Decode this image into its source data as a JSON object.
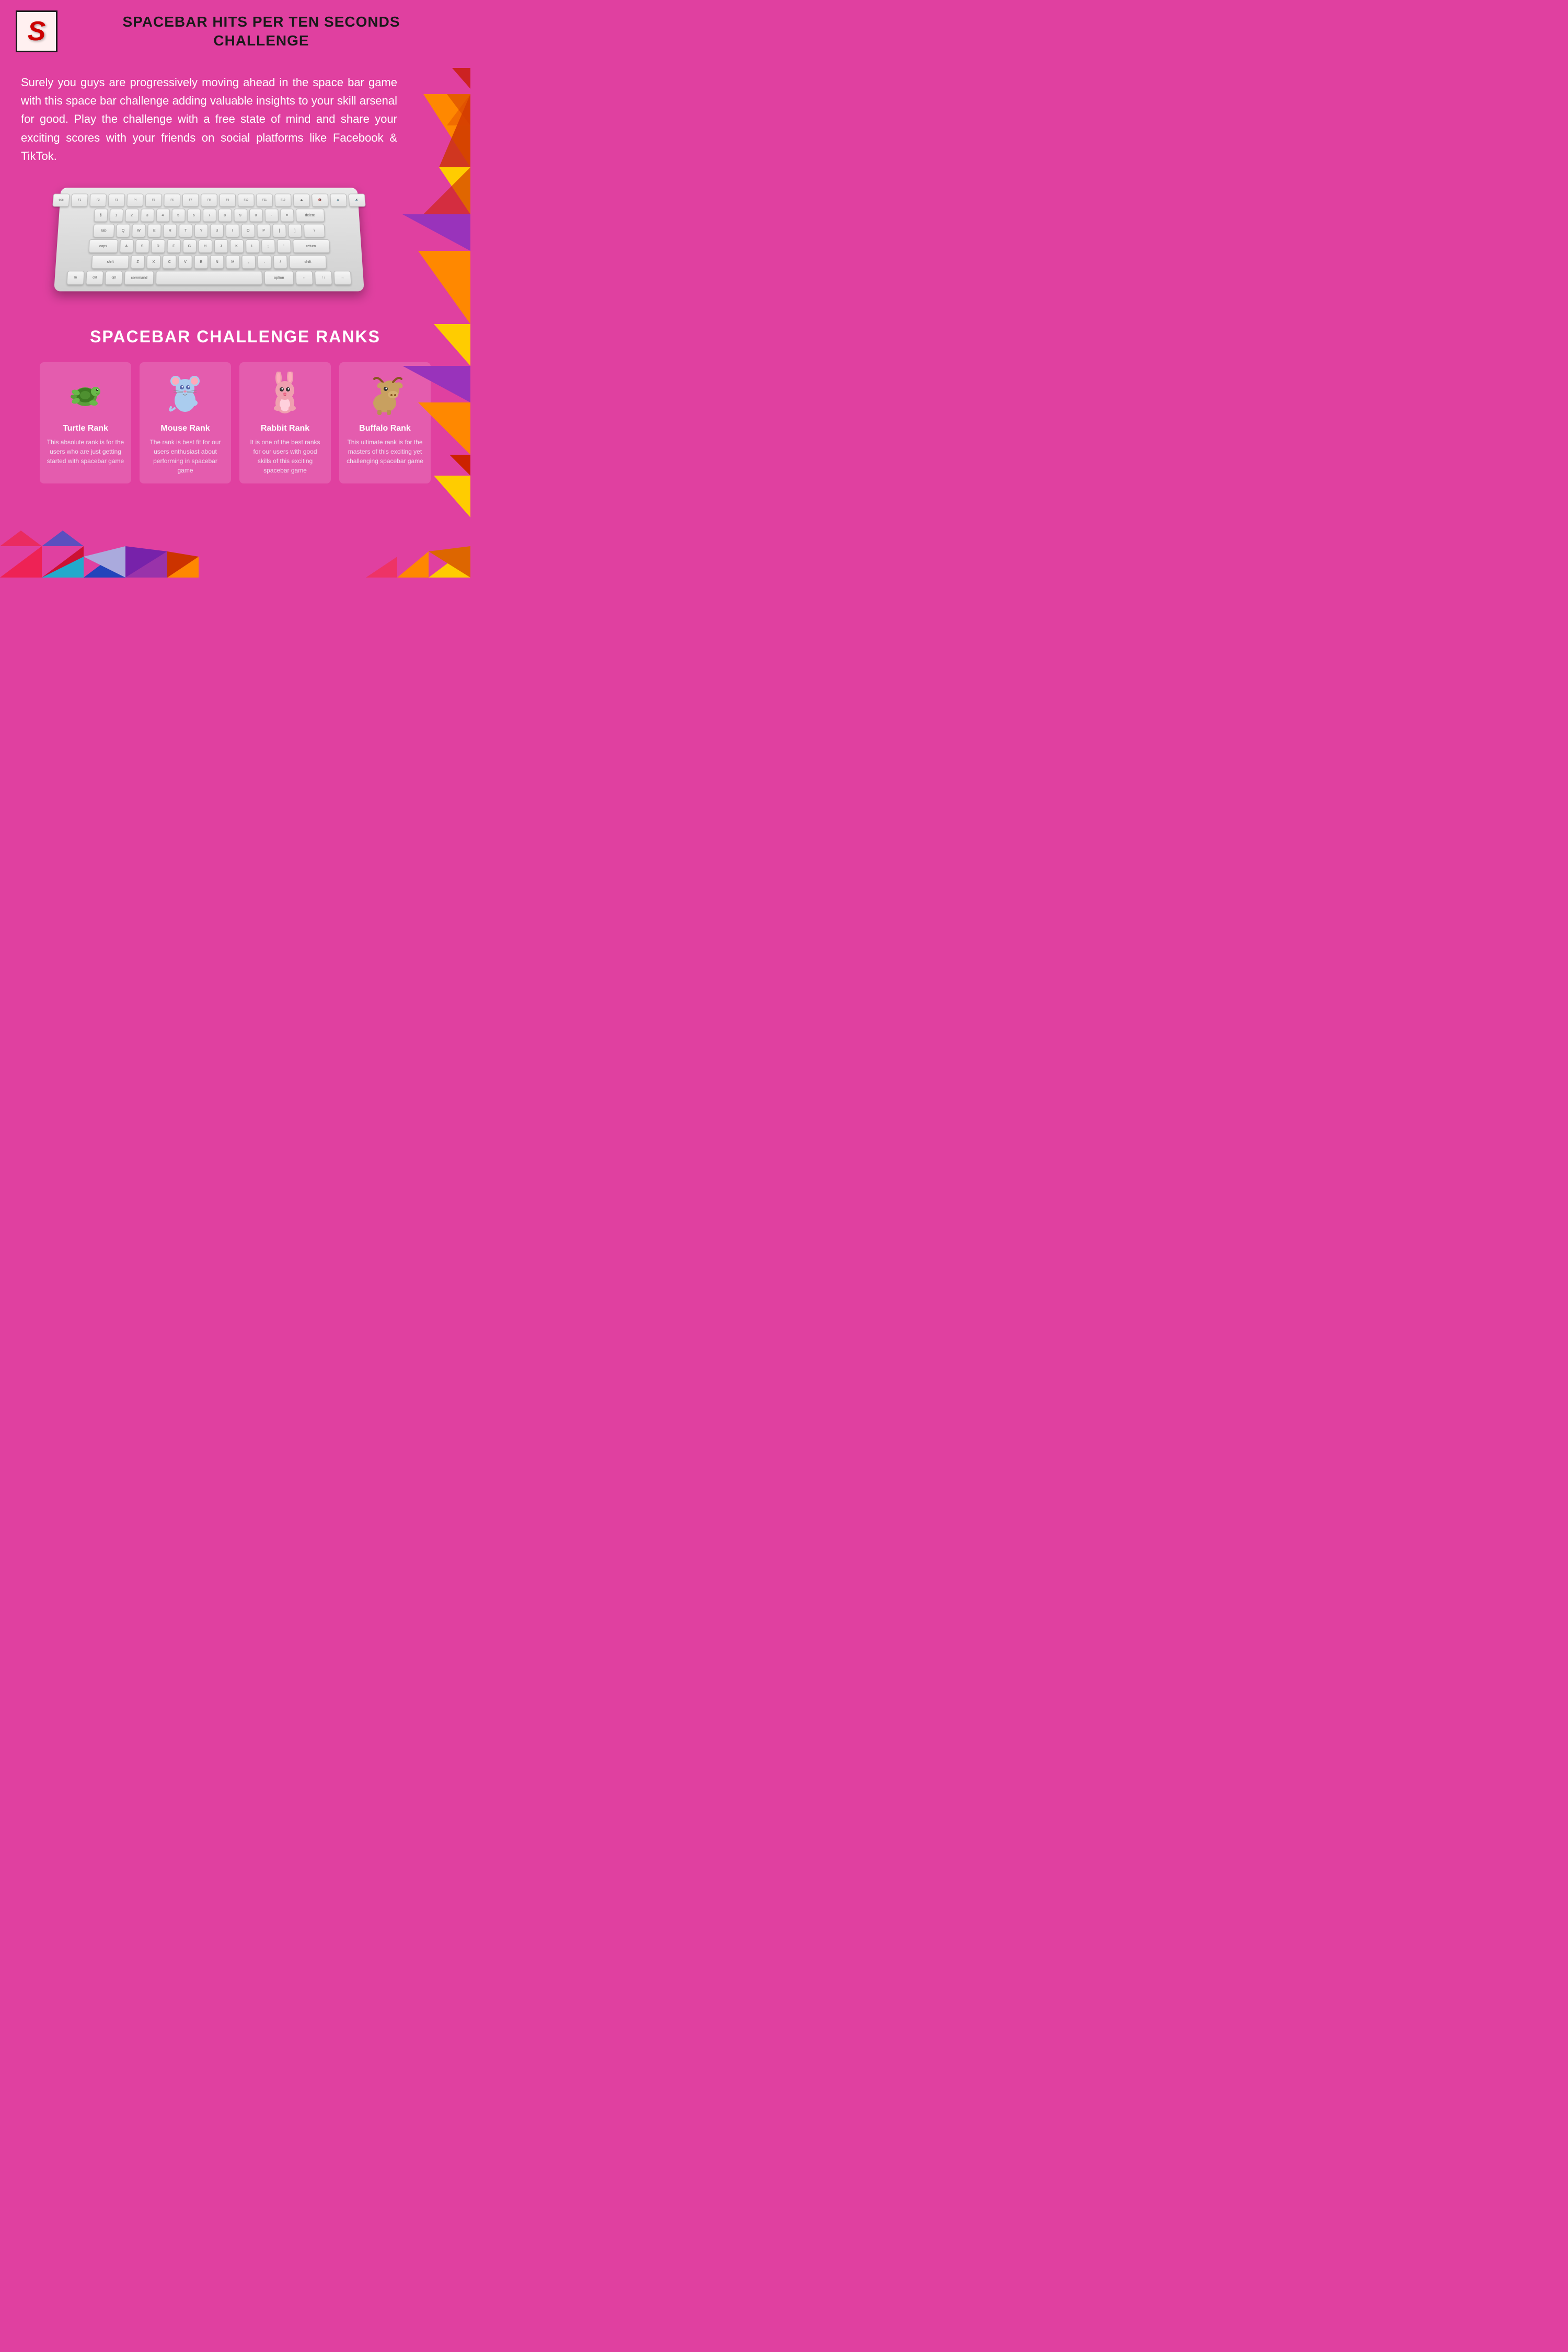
{
  "header": {
    "logo_letter": "S",
    "title_line1": "SPACEBAR HITS PER TEN SECONDS",
    "title_line2": "CHALLENGE"
  },
  "intro": {
    "text": "Surely you guys are progressively moving ahead in the space bar game with this space bar challenge adding valuable insights to your skill arsenal for good. Play the challenge with a free state of mind and share your exciting scores with your friends on social platforms like Facebook & TikTok."
  },
  "ranks_section": {
    "title": "SPACEBAR CHALLENGE RANKS",
    "ranks": [
      {
        "name": "Turtle Rank",
        "animal": "turtle",
        "description": "This absolute rank is for the users who are just getting started with spacebar game",
        "emoji": "🐢"
      },
      {
        "name": "Mouse Rank",
        "animal": "mouse",
        "description": "The rank is best fit for our users enthusiast about performing in spacebar game",
        "emoji": "🐭"
      },
      {
        "name": "Rabbit Rank",
        "animal": "rabbit",
        "description": "It is one of the best ranks for our users with good skills of this exciting spacebar game",
        "emoji": "🐰"
      },
      {
        "name": "Buffalo Rank",
        "animal": "buffalo",
        "description": "This ultimate rank is for the masters of this exciting yet challenging spacebar game",
        "emoji": "🐃"
      }
    ]
  },
  "colors": {
    "bg": "#e040a0",
    "triangle_red": "#cc2222",
    "triangle_orange": "#ff8800",
    "triangle_yellow": "#ffcc00",
    "triangle_purple": "#9933cc",
    "triangle_pink": "#ff4488",
    "triangle_blue": "#2266cc",
    "triangle_teal": "#00aacc"
  }
}
